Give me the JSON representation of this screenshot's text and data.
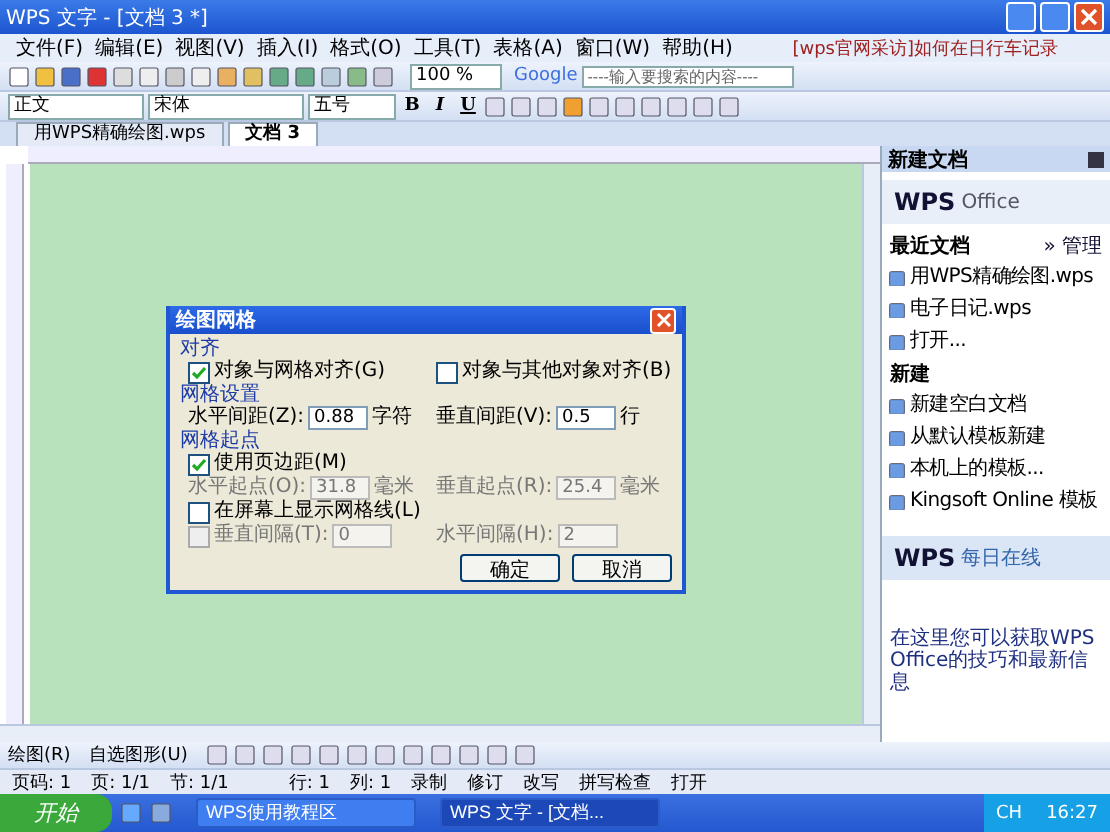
{
  "window": {
    "title": "WPS 文字 - [文档 3 *]"
  },
  "menu": {
    "items": [
      "文件(F)",
      "编辑(E)",
      "视图(V)",
      "插入(I)",
      "格式(O)",
      "工具(T)",
      "表格(A)",
      "窗口(W)",
      "帮助(H)"
    ],
    "promo": "[wps官网采访]如何在日行车记录"
  },
  "toolbar": {
    "zoom": "100 %",
    "search_brand": "Google",
    "search_placeholder": "----输入要搜索的内容----"
  },
  "format_bar": {
    "style": "正文",
    "font": "宋体",
    "size": "五号",
    "buttons": [
      "B",
      "I",
      "U"
    ]
  },
  "doc_tabs": [
    {
      "label": "用WPS精确绘图.wps",
      "selected": false
    },
    {
      "label": "文档 3",
      "selected": true
    }
  ],
  "dialog": {
    "title": "绘图网格",
    "align_label": "对齐",
    "snap": [
      {
        "label": "对象与网格对齐(G)",
        "checked": true
      },
      {
        "label": "对象与其他对象对齐(B)",
        "checked": false
      }
    ],
    "grid_label": "网格设置",
    "spacing": [
      {
        "label": "水平间距(Z):",
        "value": "0.88",
        "unit": "字符",
        "disabled": false
      },
      {
        "label": "垂直间距(V):",
        "value": "0.5",
        "unit": "行",
        "disabled": false
      }
    ],
    "origin_label": "网格起点",
    "use_margins": {
      "label": "使用页边距(M)",
      "checked": true
    },
    "origin": [
      {
        "label": "水平起点(O):",
        "value": "31.8",
        "unit": "毫米",
        "disabled": true
      },
      {
        "label": "垂直起点(R):",
        "value": "25.4",
        "unit": "毫米",
        "disabled": true
      }
    ],
    "show_grid": {
      "label": "在屏幕上显示网格线(L)",
      "checked": false
    },
    "intervals": [
      {
        "kind": "checkbox",
        "checked": false,
        "label": "垂直间隔(T):",
        "value": "0",
        "disabled": true
      },
      {
        "kind": "plain",
        "label": "水平间隔(H):",
        "value": "2",
        "disabled": true
      }
    ],
    "buttons": [
      "确定",
      "取消"
    ]
  },
  "task_pane": {
    "title": "新建文档",
    "logo": "WPS",
    "logo_sub": "Office",
    "recent_label": "最近文档",
    "manage": "» 管理",
    "recent": [
      "用WPS精确绘图.wps",
      "电子日记.wps",
      "打开..."
    ],
    "new_label": "新建",
    "new_items": [
      "新建空白文档",
      "从默认模板新建",
      "本机上的模板...",
      "Kingsoft Online 模板"
    ],
    "daily_logo": "WPS",
    "daily_title": "每日在线",
    "daily_text": "在这里您可以获取WPS Office的技巧和最新信息"
  },
  "drawing_toolbar": {
    "draw": "绘图(R)",
    "autoshape": "自选图形(U)"
  },
  "status_bar": [
    "页码: 1",
    "页: 1/1",
    "节: 1/1",
    "行: 1",
    "列: 1",
    "录制",
    "修订",
    "改写",
    "拼写检查",
    "打开"
  ],
  "taskbar": {
    "start": "开始",
    "tasks": [
      {
        "label": "WPS使用教程区",
        "selected": false
      },
      {
        "label": "WPS 文字 - [文档...",
        "selected": true
      }
    ],
    "lang": "CH",
    "clock": "16:27"
  }
}
